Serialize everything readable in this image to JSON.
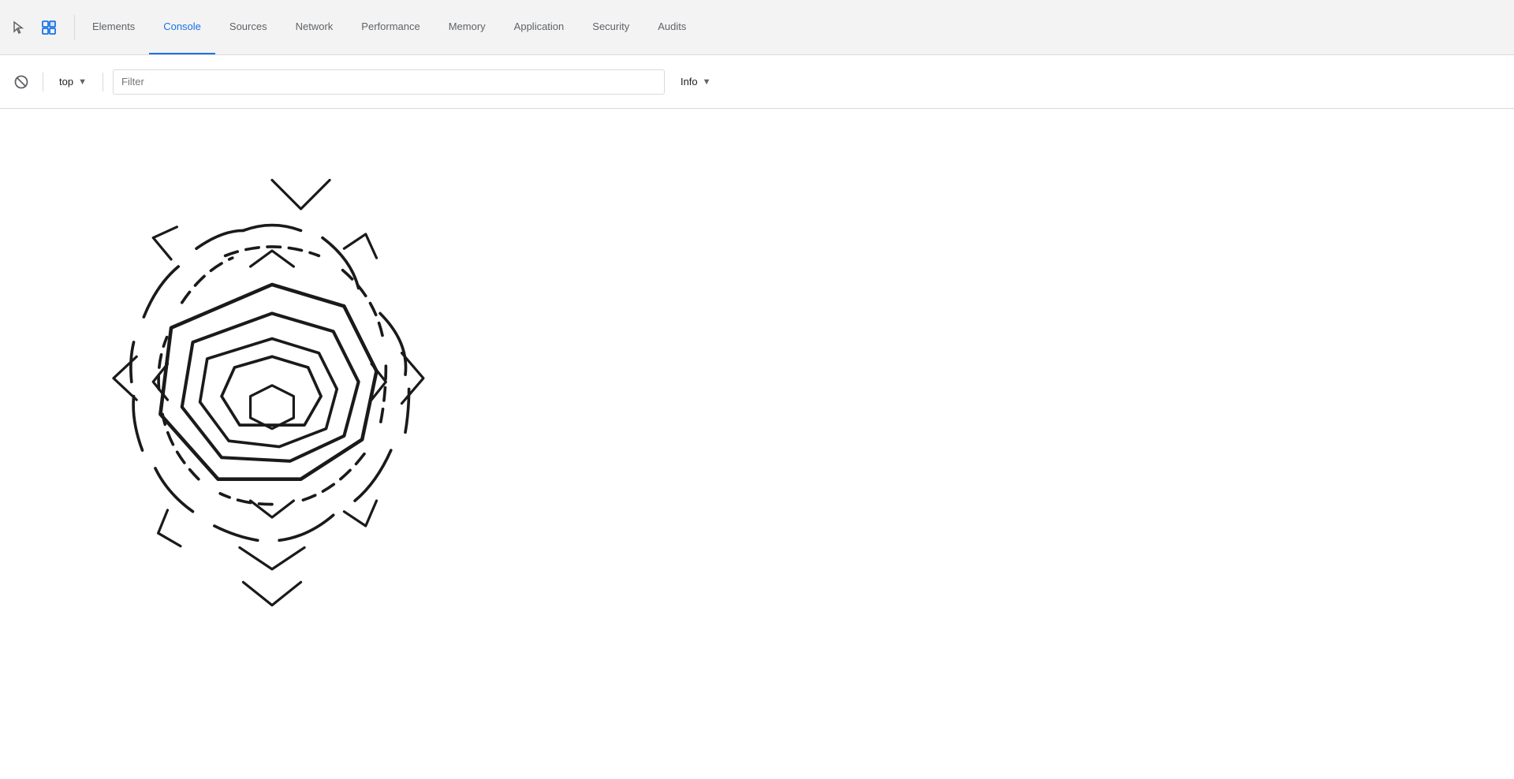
{
  "nav": {
    "tabs": [
      {
        "id": "elements",
        "label": "Elements",
        "active": false
      },
      {
        "id": "console",
        "label": "Console",
        "active": true
      },
      {
        "id": "sources",
        "label": "Sources",
        "active": false
      },
      {
        "id": "network",
        "label": "Network",
        "active": false
      },
      {
        "id": "performance",
        "label": "Performance",
        "active": false
      },
      {
        "id": "memory",
        "label": "Memory",
        "active": false
      },
      {
        "id": "application",
        "label": "Application",
        "active": false
      },
      {
        "id": "security",
        "label": "Security",
        "active": false
      },
      {
        "id": "audits",
        "label": "Audits",
        "active": false
      }
    ]
  },
  "toolbar": {
    "context": "top",
    "context_dropdown_icon": "▼",
    "filter_placeholder": "Filter",
    "level": "Info",
    "level_dropdown_icon": "▼"
  }
}
